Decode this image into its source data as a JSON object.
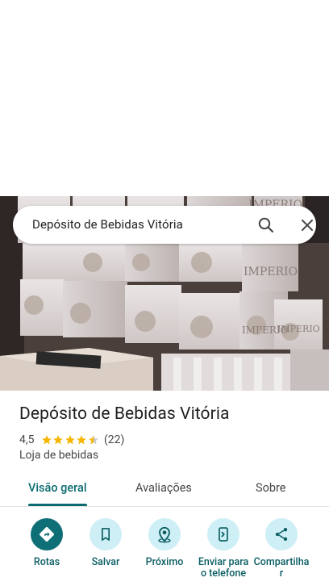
{
  "search": {
    "query": "Depósito de Bebidas Vitória"
  },
  "place": {
    "name": "Depósito de Bebidas Vitória",
    "rating": "4,5",
    "stars": 4.5,
    "reviews": "(22)",
    "category": "Loja de bebidas"
  },
  "tabs": [
    {
      "label": "Visão geral",
      "active": true
    },
    {
      "label": "Avaliações",
      "active": false
    },
    {
      "label": "Sobre",
      "active": false
    }
  ],
  "actions": [
    {
      "label": "Rotas",
      "icon": "directions-icon"
    },
    {
      "label": "Salvar",
      "icon": "bookmark-icon"
    },
    {
      "label": "Próximo",
      "icon": "nearby-icon"
    },
    {
      "label": "Enviar para o telefone",
      "icon": "send-to-phone-icon"
    },
    {
      "label": "Compartilhar",
      "icon": "share-icon"
    }
  ],
  "colors": {
    "accent": "#0b6b70",
    "action_bg": "#cdeff5",
    "primary_action_bg": "#0e6f76",
    "star": "#f6b500"
  }
}
